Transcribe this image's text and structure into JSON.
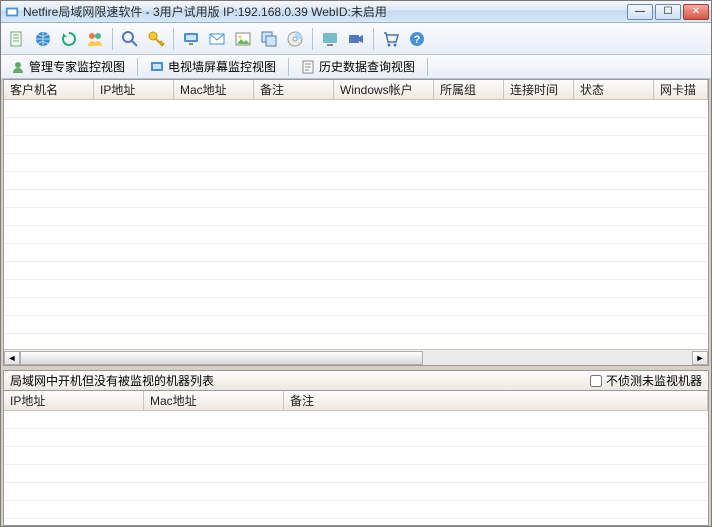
{
  "window": {
    "title": "Netfire局域网限速软件 - 3用户试用版 IP:192.168.0.39 WebID:未启用",
    "min": "—",
    "max": "☐",
    "close": "✕"
  },
  "viewtabs": {
    "v1": "管理专家监控视图",
    "v2": "电视墙屏幕监控视图",
    "v3": "历史数据查询视图"
  },
  "top_columns": {
    "c0": "客户机名",
    "c1": "IP地址",
    "c2": "Mac地址",
    "c3": "备注",
    "c4": "Windows帐户",
    "c5": "所属组",
    "c6": "连接时间",
    "c7": "状态",
    "c8": "网卡描"
  },
  "bottom": {
    "title": "局域网中开机但没有被监视的机器列表",
    "chk_label": "不侦测未监视机器",
    "columns": {
      "c0": "IP地址",
      "c1": "Mac地址",
      "c2": "备注"
    }
  }
}
